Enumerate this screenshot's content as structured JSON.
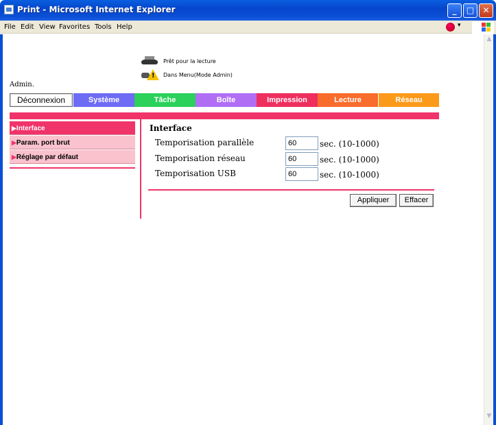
{
  "window": {
    "title": "Print - Microsoft Internet Explorer",
    "min_glyph": "_",
    "max_glyph": "□",
    "close_glyph": "✕"
  },
  "menu": [
    "File",
    "Edit",
    "View",
    "Favorites",
    "Tools",
    "Help"
  ],
  "status": {
    "ready": "Prêt pour la lecture",
    "mode": "Dans Menu(Mode Admin)"
  },
  "admin_label": "Admin.",
  "tabs": {
    "logout": "Déconnexion",
    "items": [
      {
        "label": "Système",
        "color": "#6e6bf5"
      },
      {
        "label": "Tâche",
        "color": "#2bd15a"
      },
      {
        "label": "Boîte",
        "color": "#b06ef5"
      },
      {
        "label": "Impression",
        "color": "#ef2f5e"
      },
      {
        "label": "Lecture",
        "color": "#f86c2c"
      },
      {
        "label": "Réseau",
        "color": "#fb9a1a"
      }
    ]
  },
  "sidebar": {
    "arrow": "▶",
    "items": [
      {
        "label": "Interface",
        "active": true
      },
      {
        "label": "Param. port brut",
        "active": false
      },
      {
        "label": "Réglage par défaut",
        "active": false
      }
    ]
  },
  "form": {
    "title": "Interface",
    "rows": [
      {
        "label": "Temporisation parallèle",
        "value": "60",
        "unit": "sec. (10-1000)"
      },
      {
        "label": "Temporisation réseau",
        "value": "60",
        "unit": "sec. (10-1000)"
      },
      {
        "label": "Temporisation USB",
        "value": "60",
        "unit": "sec. (10-1000)"
      }
    ],
    "apply_label": "Appliquer",
    "clear_label": "Effacer"
  },
  "colors": {
    "accent": "#f0346a",
    "titlebar": "#0a4fd6"
  }
}
